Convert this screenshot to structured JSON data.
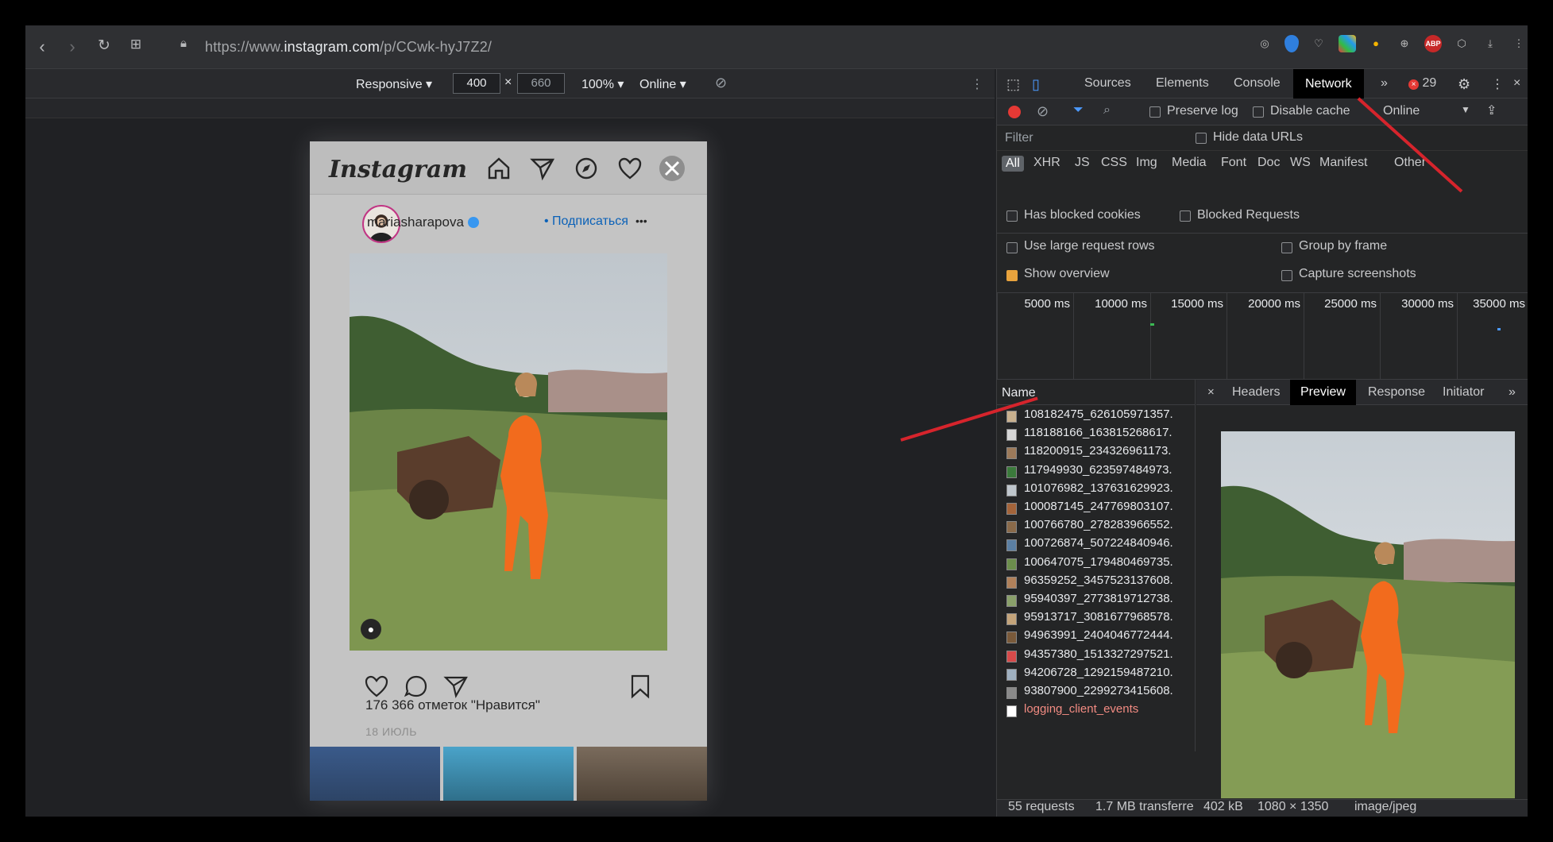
{
  "browser": {
    "url_prefix": "https://www.",
    "url_domain": "instagram.com",
    "url_path": "/p/CCwk-hyJ7Z2/",
    "abp_label": "ABP"
  },
  "device_toolbar": {
    "mode": "Responsive ▾",
    "width": "400",
    "times": "×",
    "height": "660",
    "zoom": "100% ▾",
    "throttle": "Online ▾"
  },
  "instagram": {
    "logo": "Instagram",
    "username": "mariasharapova",
    "follow_label": "• Подписаться",
    "more": "•••",
    "likes": "176 366 отметок \"Нравится\"",
    "date": "18 ИЮЛЬ"
  },
  "devtools": {
    "tabs": [
      "Sources",
      "Elements",
      "Console",
      "Network"
    ],
    "active_tab": "Network",
    "more_tabs": "»",
    "error_count": "29",
    "preserve_log": "Preserve log",
    "disable_cache": "Disable cache",
    "online": "Online",
    "filter_placeholder": "Filter",
    "hide_data_urls": "Hide data URLs",
    "types": [
      "All",
      "XHR",
      "JS",
      "CSS",
      "Img",
      "Media",
      "Font",
      "Doc",
      "WS",
      "Manifest",
      "Other"
    ],
    "has_blocked_cookies": "Has blocked cookies",
    "blocked_requests": "Blocked Requests",
    "large_rows": "Use large request rows",
    "group_by_frame": "Group by frame",
    "show_overview": "Show overview",
    "capture_screenshots": "Capture screenshots",
    "timeline_ticks": [
      "5000 ms",
      "10000 ms",
      "15000 ms",
      "20000 ms",
      "25000 ms",
      "30000 ms",
      "35000 ms"
    ],
    "name_header": "Name",
    "requests": [
      "108182475_626105971357.",
      "118188166_163815268617.",
      "118200915_234326961173.",
      "117949930_623597484973.",
      "101076982_137631629923.",
      "100087145_247769803107.",
      "100766780_278283966552.",
      "100726874_507224840946.",
      "100647075_179480469735.",
      "96359252_3457523137608.",
      "95940397_2773819712738.",
      "95913717_3081677968578.",
      "94963991_2404046772444.",
      "94357380_1513327297521.",
      "94206728_1292159487210.",
      "93807900_2299273415608."
    ],
    "last_request": "logging_client_events",
    "detail_tabs": [
      "Headers",
      "Preview",
      "Response",
      "Initiator"
    ],
    "active_detail_tab": "Preview",
    "close": "×",
    "status_requests": "55 requests",
    "status_transferred": "1.7 MB transferre",
    "preview_size": "402 kB",
    "preview_dims": "1080 × 1350",
    "preview_type": "image/jpeg"
  },
  "colors": {
    "accent_arrow": "#d6242c",
    "error_red": "#e53935",
    "checkbox_on": "#e8a33d",
    "orange_outfit": "#f26b1d"
  }
}
